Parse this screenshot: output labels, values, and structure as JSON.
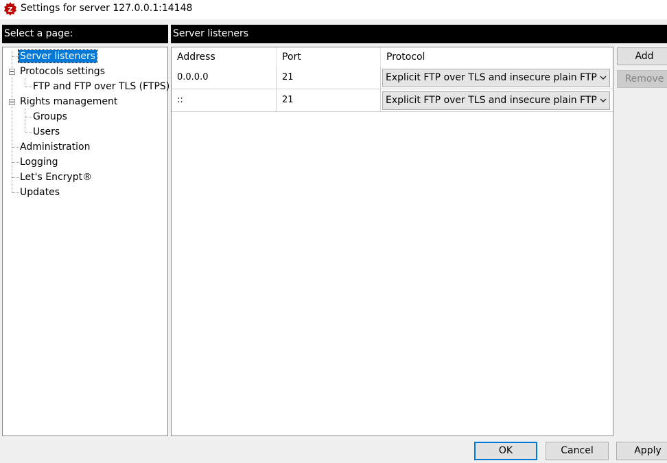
{
  "window": {
    "title": "Settings for server 127.0.0.1:14148",
    "icon": "filezilla-server-icon"
  },
  "left_panel": {
    "header": "Select a page:",
    "tree": [
      {
        "label": "Server listeners",
        "selected": true
      },
      {
        "label": "Protocols settings",
        "expanded": true
      },
      {
        "label": "FTP and FTP over TLS (FTPS)"
      },
      {
        "label": "Rights management",
        "expanded": true
      },
      {
        "label": "Groups"
      },
      {
        "label": "Users"
      },
      {
        "label": "Administration"
      },
      {
        "label": "Logging"
      },
      {
        "label": "Let's Encrypt®"
      },
      {
        "label": "Updates"
      }
    ]
  },
  "right_panel": {
    "header": "Server listeners",
    "columns": [
      "Address",
      "Port",
      "Protocol"
    ],
    "rows": [
      {
        "address": "0.0.0.0",
        "port": "21",
        "protocol": "Explicit FTP over TLS and insecure plain FTP"
      },
      {
        "address": "::",
        "port": "21",
        "protocol": "Explicit FTP over TLS and insecure plain FTP"
      }
    ],
    "add_label": "Add",
    "remove_label": "Remove"
  },
  "footer": {
    "ok_label": "OK",
    "cancel_label": "Cancel",
    "apply_label": "Apply"
  }
}
